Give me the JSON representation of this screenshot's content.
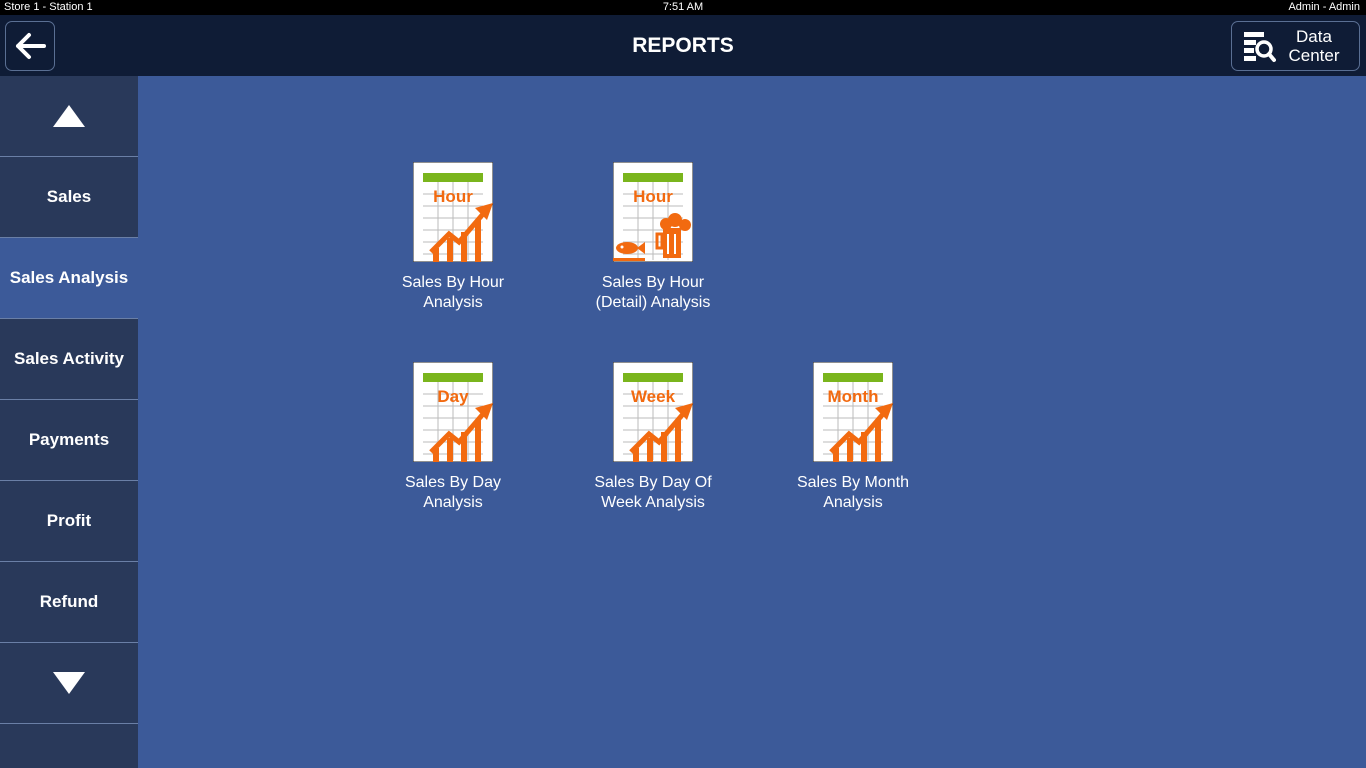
{
  "status_bar": {
    "store_station": "Store 1 - Station 1",
    "time": "7:51 AM",
    "user": "Admin - Admin"
  },
  "header": {
    "title": "REPORTS",
    "back_icon": "arrow-left-icon",
    "data_center_label_line1": "Data",
    "data_center_label_line2": "Center",
    "data_center_icon": "data-search-icon"
  },
  "sidebar": {
    "scroll_up_icon": "triangle-up-icon",
    "scroll_down_icon": "triangle-down-icon",
    "items": [
      {
        "label": "Sales",
        "active": false
      },
      {
        "label": "Sales Analysis",
        "active": true
      },
      {
        "label": "Sales Activity",
        "active": false
      },
      {
        "label": "Payments",
        "active": false
      },
      {
        "label": "Profit",
        "active": false
      },
      {
        "label": "Refund",
        "active": false
      }
    ]
  },
  "reports": [
    {
      "icon_text": "Hour",
      "label_line1": "Sales By Hour",
      "label_line2": "Analysis",
      "icon": "hour-chart-icon"
    },
    {
      "icon_text": "Hour",
      "label_line1": "Sales By Hour",
      "label_line2": "(Detail) Analysis",
      "icon": "hour-detail-food-icon"
    },
    {
      "icon_text": "Day",
      "label_line1": "Sales By Day",
      "label_line2": "Analysis",
      "icon": "day-chart-icon"
    },
    {
      "icon_text": "Week",
      "label_line1": "Sales By Day Of",
      "label_line2": "Week Analysis",
      "icon": "week-chart-icon"
    },
    {
      "icon_text": "Month",
      "label_line1": "Sales By Month",
      "label_line2": "Analysis",
      "icon": "month-chart-icon"
    }
  ],
  "colors": {
    "background": "#3c5a99",
    "header": "#0f1c36",
    "sidebar": "#29395a",
    "icon_orange": "#f26a10",
    "icon_green": "#7ab51d"
  }
}
